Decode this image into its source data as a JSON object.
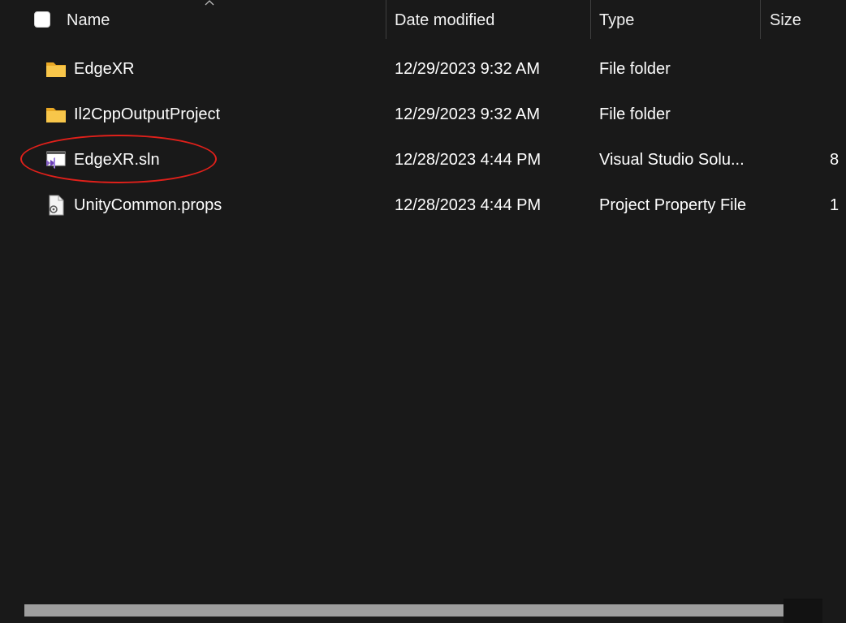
{
  "header": {
    "name_label": "Name",
    "date_label": "Date modified",
    "type_label": "Type",
    "size_label": "Size",
    "sort_indicator": "sort-ascending-icon"
  },
  "files": [
    {
      "name": "EdgeXR",
      "date": "12/29/2023 9:32 AM",
      "type": "File folder",
      "size": "",
      "icon": "folder-icon"
    },
    {
      "name": "Il2CppOutputProject",
      "date": "12/29/2023 9:32 AM",
      "type": "File folder",
      "size": "",
      "icon": "folder-icon"
    },
    {
      "name": "EdgeXR.sln",
      "date": "12/28/2023 4:44 PM",
      "type": "Visual Studio Solu...",
      "size": "8",
      "icon": "visual-studio-solution-icon"
    },
    {
      "name": "UnityCommon.props",
      "date": "12/28/2023 4:44 PM",
      "type": "Project Property File",
      "size": "1",
      "icon": "property-file-icon"
    }
  ],
  "annotation": {
    "color": "#e0201a",
    "target": "EdgeXR.sln"
  },
  "colors": {
    "background": "#191919",
    "folder": "#f5c542",
    "vs_purple": "#8661c5"
  }
}
